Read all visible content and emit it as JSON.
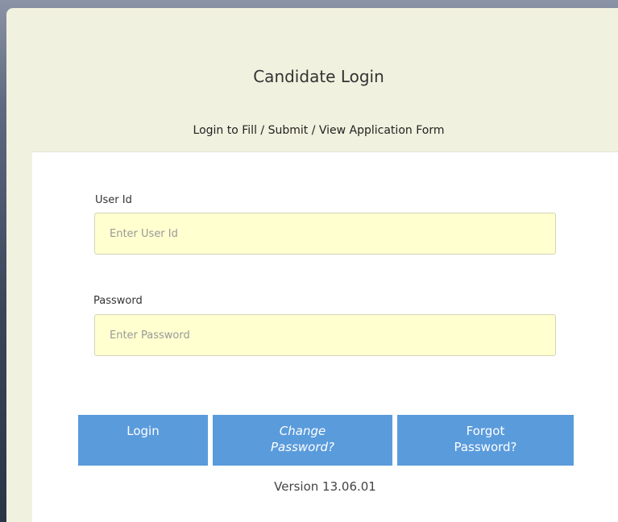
{
  "login": {
    "title": "Candidate Login",
    "subtitle": "Login to Fill / Submit / View Application Form",
    "user_id": {
      "label": "User Id",
      "placeholder": "Enter User Id",
      "value": ""
    },
    "password": {
      "label": "Password",
      "placeholder": "Enter Password",
      "value": ""
    },
    "buttons": {
      "login": "Login",
      "change_password_line1": "Change",
      "change_password_line2": "Password?",
      "forgot_password_line1": "Forgot",
      "forgot_password_line2": "Password?"
    },
    "version": "Version 13.06.01"
  },
  "colors": {
    "card_background": "#f1f1df",
    "input_background": "#ffffcf",
    "button_background": "#5a9bdc",
    "button_text": "#ffffff"
  }
}
